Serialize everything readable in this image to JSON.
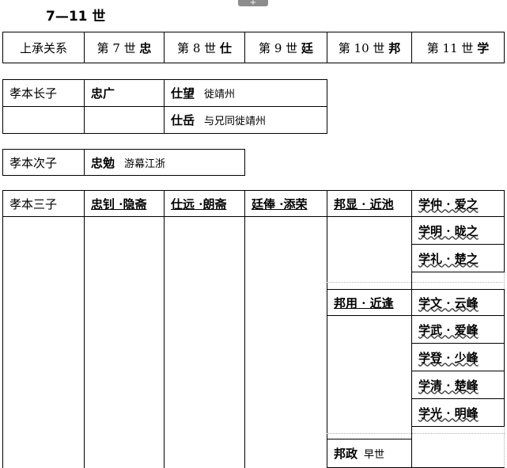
{
  "title": "7—11 世",
  "header": {
    "relation": "上承关系",
    "gen7": {
      "label": "第 7 世",
      "char": "忠"
    },
    "gen8": {
      "label": "第 8 世",
      "char": "仕"
    },
    "gen9": {
      "label": "第 9 世",
      "char": "廷"
    },
    "gen10": {
      "label": "第 10 世",
      "char": "邦"
    },
    "gen11": {
      "label": "第 11 世",
      "char": "学"
    }
  },
  "son1": {
    "label": "孝本长子",
    "gen7": "忠广",
    "gen8": [
      {
        "name": "仕望",
        "note": "徙靖州"
      },
      {
        "name": "仕岳",
        "note": "与兄同徙靖州"
      }
    ]
  },
  "son2": {
    "label": "孝本次子",
    "gen7": "忠勉",
    "note": "游幕江浙"
  },
  "son3": {
    "label": "孝本三子",
    "gen7": "忠钊 ·隐斋",
    "gen8": "仕远 ·朗斋",
    "gen9": "廷俸 ·添荣",
    "gen10": [
      {
        "name": "邦显 · 近池"
      },
      {
        "name": "邦用 · 近逢"
      },
      {
        "name": "邦政",
        "note": "早世"
      }
    ],
    "gen11": [
      "学仲 · 爱之",
      "学明 · 昽之",
      "学礼 · 楚之",
      "学文 · 云峰",
      "学武 · 爱峰",
      "学登 · 少峰",
      "学清 · 楚峰",
      "学光 · 明峰"
    ]
  }
}
